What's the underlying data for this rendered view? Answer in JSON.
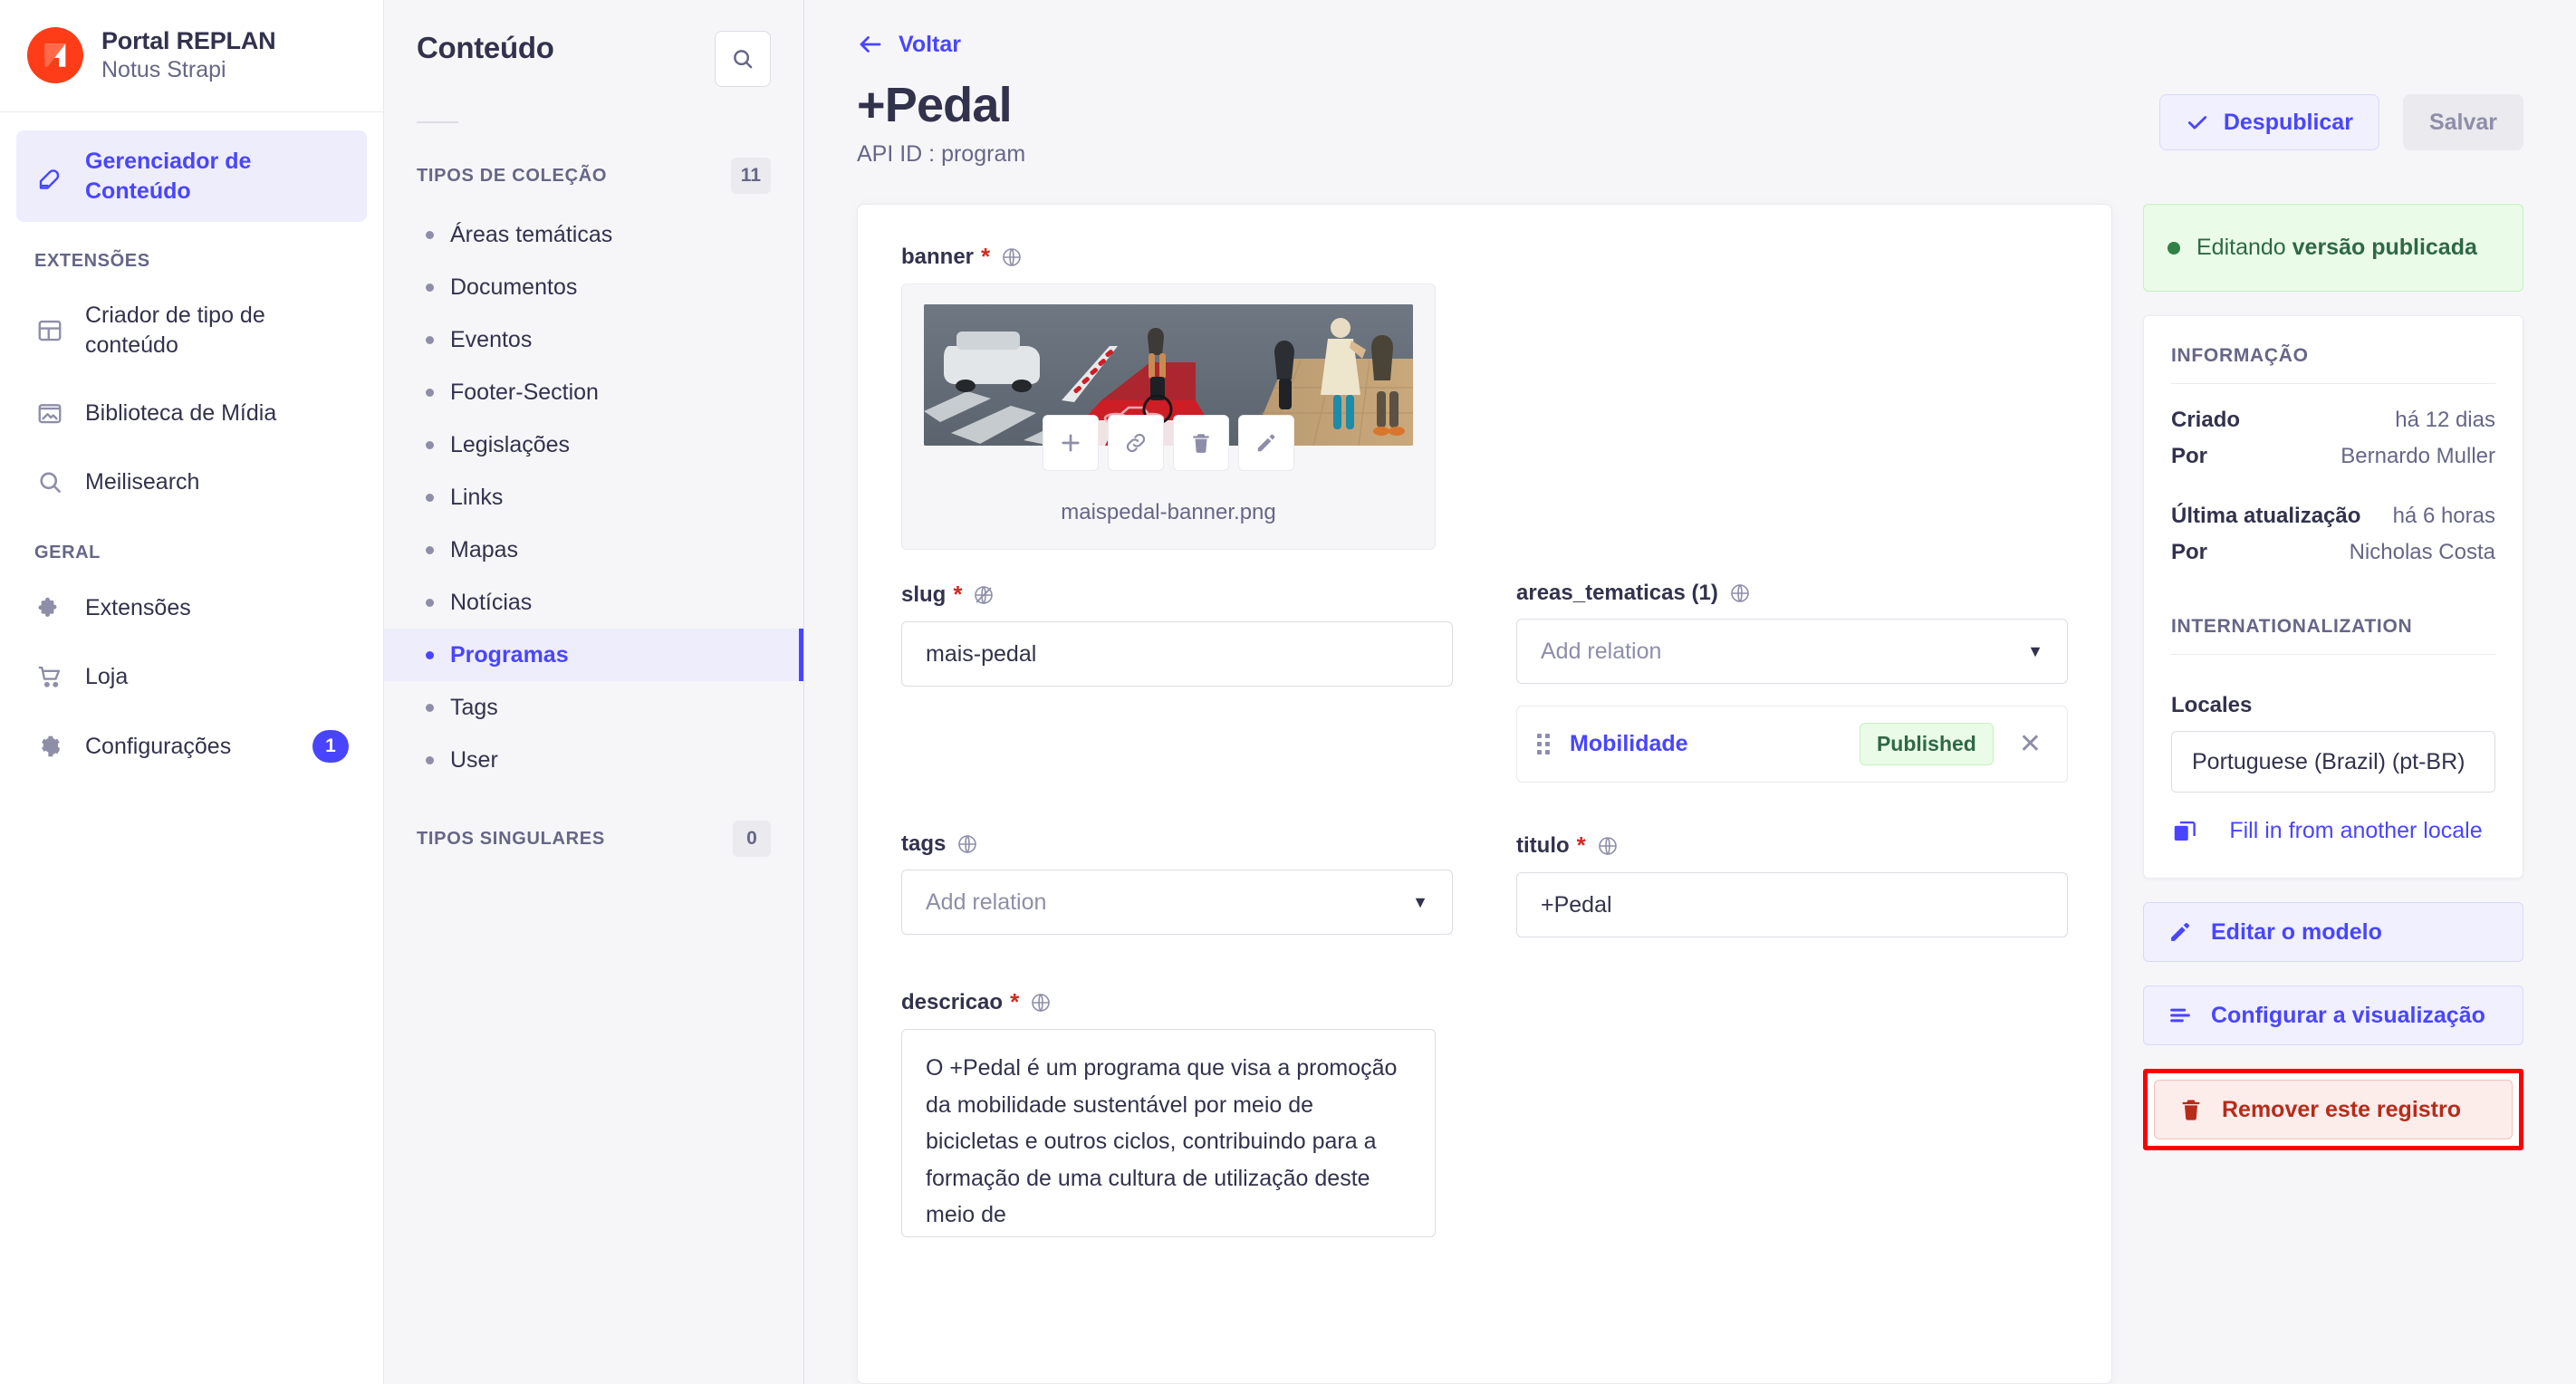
{
  "brand": {
    "logo_icon": "strapi-logo-icon",
    "title": "Portal REPLAN",
    "subtitle": "Notus Strapi"
  },
  "sidebar": {
    "primary": [
      {
        "label": "Gerenciador de Conteúdo",
        "icon": "feather-pen-icon",
        "active": true
      }
    ],
    "sections": [
      {
        "title": "EXTENSÕES",
        "items": [
          {
            "label": "Criador de tipo de conteúdo",
            "icon": "layout-blocks-icon"
          },
          {
            "label": "Biblioteca de Mídia",
            "icon": "image-icon"
          },
          {
            "label": "Meilisearch",
            "icon": "magnifier-icon"
          }
        ]
      },
      {
        "title": "GERAL",
        "items": [
          {
            "label": "Extensões",
            "icon": "puzzle-piece-icon"
          },
          {
            "label": "Loja",
            "icon": "shopping-cart-icon"
          },
          {
            "label": "Configurações",
            "icon": "gear-icon",
            "badge": "1"
          }
        ]
      }
    ]
  },
  "content_panel": {
    "title": "Conteúdo",
    "search_icon": "magnifier-icon",
    "groups": [
      {
        "title": "TIPOS DE COLEÇÃO",
        "count": "11",
        "items": [
          {
            "label": "Áreas temáticas"
          },
          {
            "label": "Documentos"
          },
          {
            "label": "Eventos"
          },
          {
            "label": "Footer-Section"
          },
          {
            "label": "Legislações"
          },
          {
            "label": "Links"
          },
          {
            "label": "Mapas"
          },
          {
            "label": "Notícias"
          },
          {
            "label": "Programas",
            "active": true
          },
          {
            "label": "Tags"
          },
          {
            "label": "User"
          }
        ]
      },
      {
        "title": "TIPOS SINGULARES",
        "count": "0",
        "items": []
      }
    ]
  },
  "header": {
    "back_label": "Voltar",
    "back_icon": "arrow-left-icon",
    "title": "+Pedal",
    "api_id": "API ID : program",
    "unpublish_label": "Despublicar",
    "unpublish_icon": "check-icon",
    "save_label": "Salvar"
  },
  "form": {
    "banner": {
      "label": "banner",
      "required": "*",
      "i18n_icon": "globe-icon",
      "filename": "maispedal-banner.png",
      "actions": [
        "plus-icon",
        "link-icon",
        "trash-icon",
        "pencil-icon"
      ]
    },
    "slug": {
      "label": "slug",
      "required": "*",
      "i18n_icon": "unlink-globe-icon",
      "value": "mais-pedal"
    },
    "areas_tematicas": {
      "label": "areas_tematicas (1)",
      "i18n_icon": "globe-icon",
      "placeholder": "Add relation",
      "relations": [
        {
          "name": "Mobilidade",
          "status": "Published"
        }
      ]
    },
    "tags": {
      "label": "tags",
      "i18n_icon": "globe-icon",
      "placeholder": "Add relation"
    },
    "titulo": {
      "label": "titulo",
      "required": "*",
      "i18n_icon": "globe-icon",
      "value": "+Pedal"
    },
    "descricao": {
      "label": "descricao",
      "required": "*",
      "i18n_icon": "globe-icon",
      "value": "O +Pedal é um programa que visa a promoção da mobilidade sustentável por meio de bicicletas e outros ciclos, contribuindo para a formação de uma cultura de utilização deste meio de"
    }
  },
  "right_panel": {
    "status": {
      "prefix": "Editando ",
      "strong": "versão publicada"
    },
    "information": {
      "section_title": "INFORMAÇÃO",
      "rows": [
        {
          "key": "Criado",
          "value": "há 12 dias"
        },
        {
          "key": "Por",
          "value": "Bernardo Muller"
        },
        {
          "key": "Última atualização",
          "value": "há 6 horas"
        },
        {
          "key": "Por",
          "value": "Nicholas Costa"
        }
      ]
    },
    "internationalization": {
      "section_title": "INTERNATIONALIZATION",
      "locales_label": "Locales",
      "locale_value": "Portuguese (Brazil) (pt-BR)",
      "fill_label": "Fill in from another locale",
      "fill_icon": "copy-icon"
    },
    "actions": [
      {
        "label": "Editar o modelo",
        "icon": "pencil-icon"
      },
      {
        "label": "Configurar a visualização",
        "icon": "sliders-icon"
      },
      {
        "label": "Remover este registro",
        "icon": "trash-icon",
        "danger": true,
        "highlighted": true
      }
    ]
  },
  "colors": {
    "accent": "#4945ff",
    "brand": "#ff3c18",
    "success": "#328048",
    "danger": "#b72b1a",
    "highlight_outline": "#ff0000"
  }
}
